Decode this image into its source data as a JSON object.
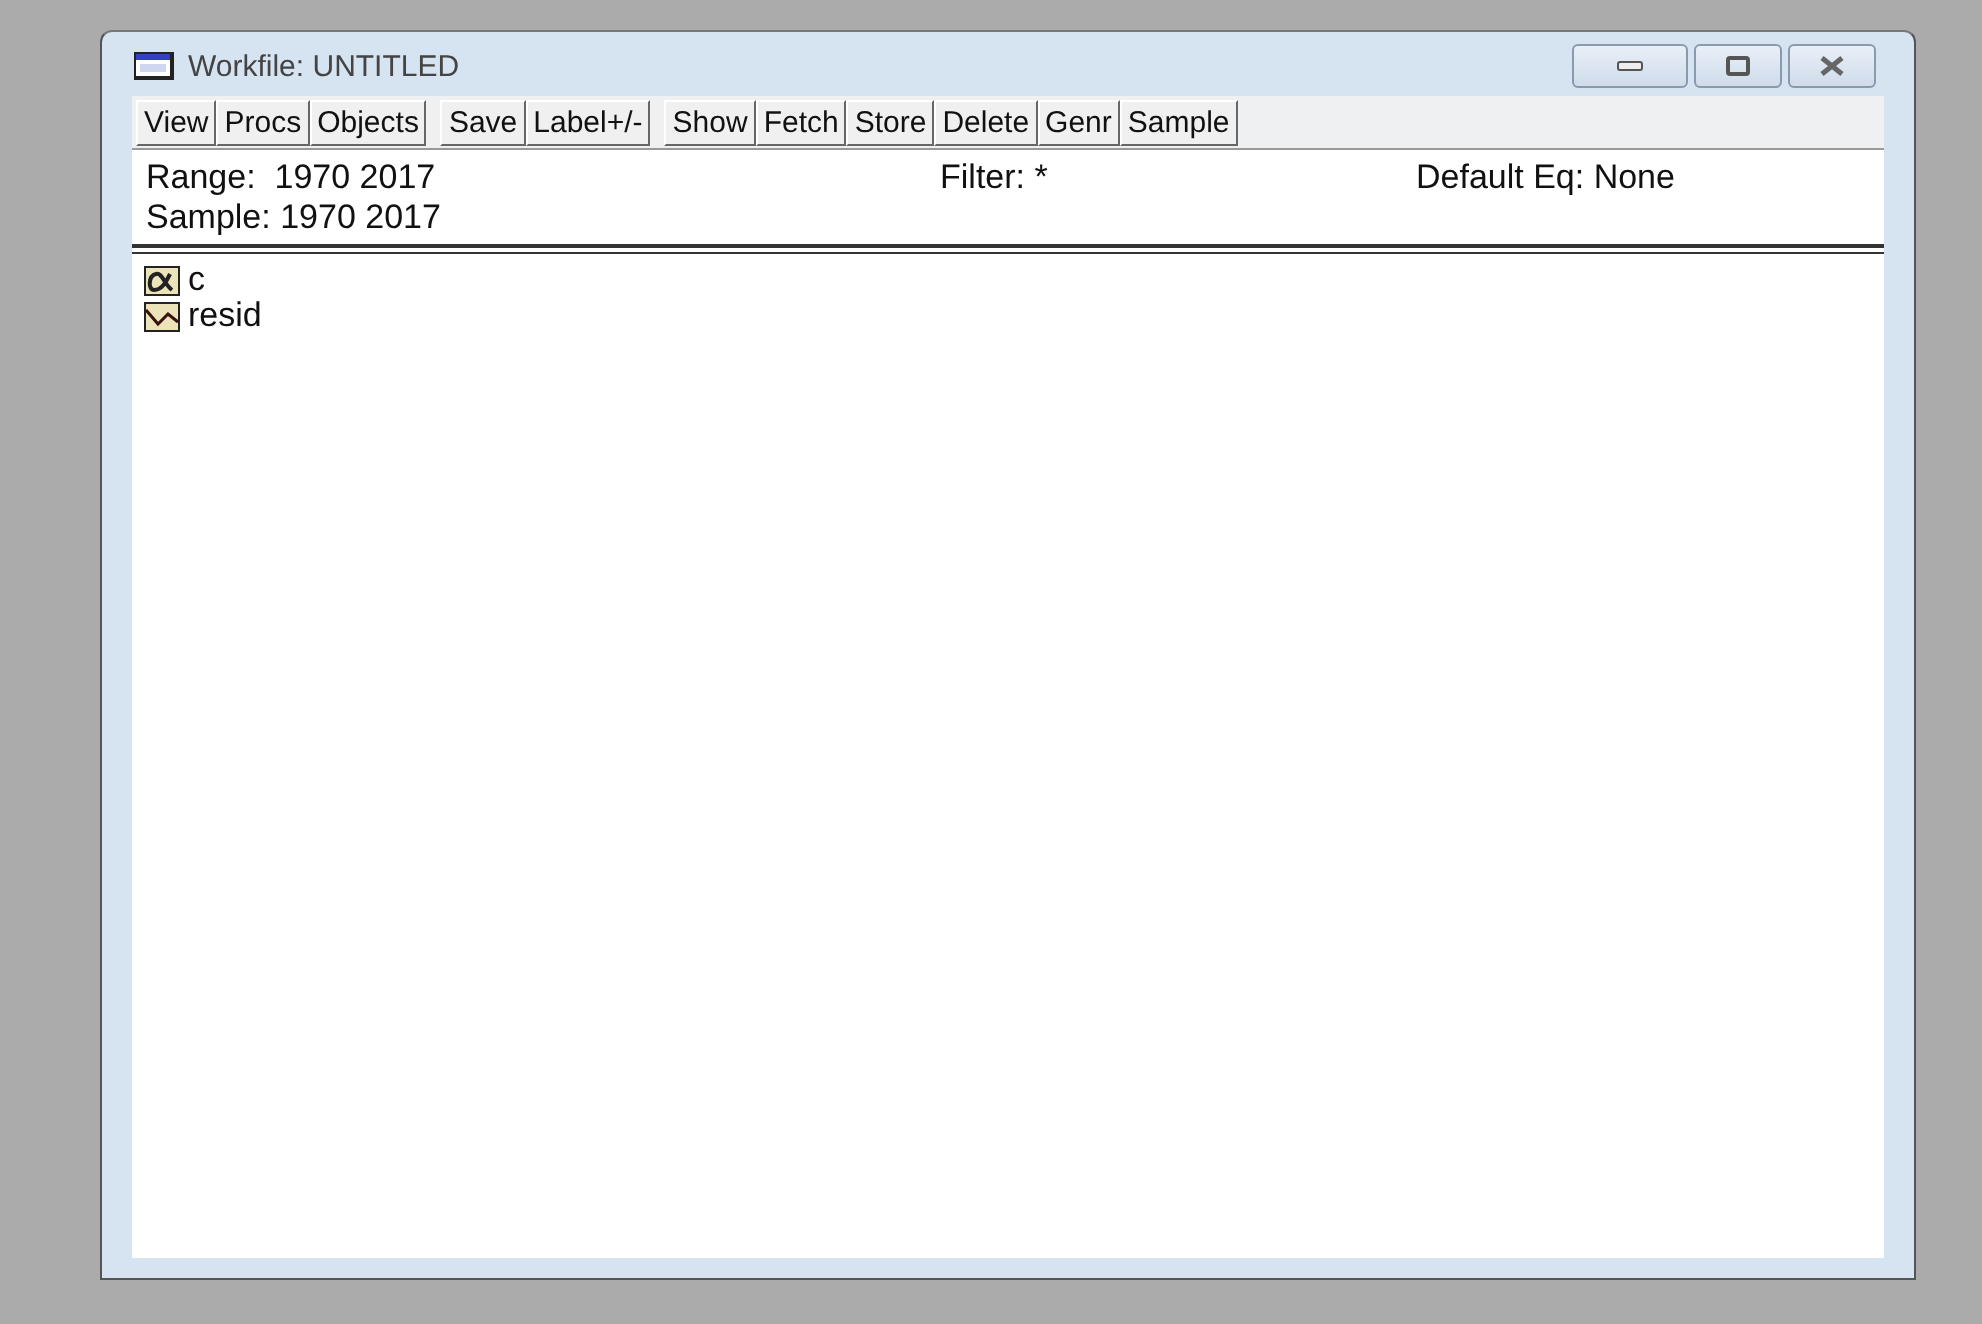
{
  "window": {
    "title": "Workfile: UNTITLED"
  },
  "toolbar": [
    [
      "View",
      "Procs",
      "Objects"
    ],
    [
      "Save",
      "Label+/-"
    ],
    [
      "Show",
      "Fetch",
      "Store",
      "Delete",
      "Genr",
      "Sample"
    ]
  ],
  "info": {
    "range": "Range:  1970 2017",
    "sample": "Sample: 1970 2017",
    "filter": "Filter: *",
    "default_eq": "Default Eq: None"
  },
  "objects": [
    {
      "name": "c",
      "kind": "coefficient"
    },
    {
      "name": "resid",
      "kind": "series"
    }
  ]
}
